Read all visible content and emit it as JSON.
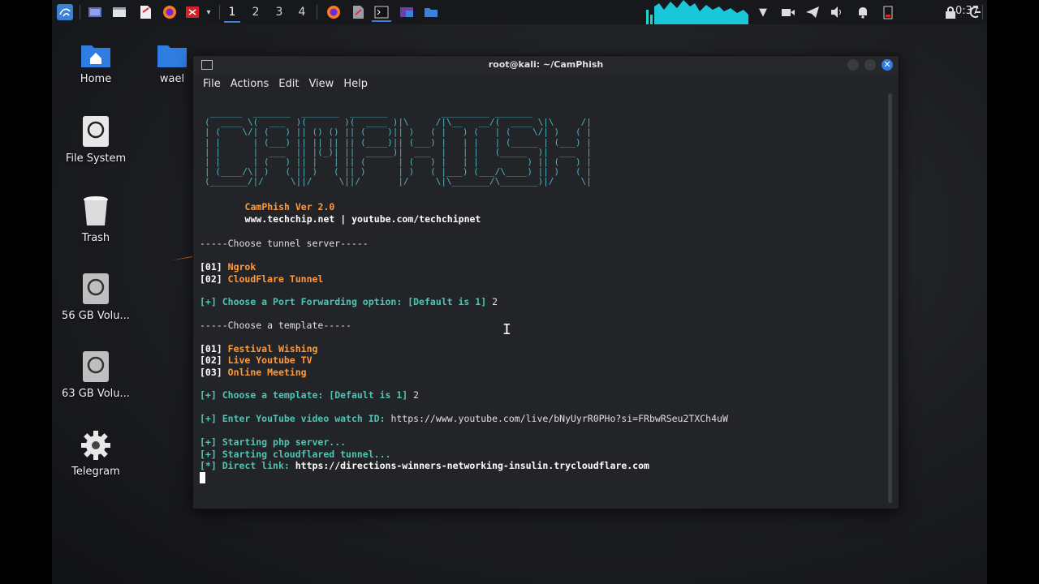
{
  "panel": {
    "workspaces": [
      "1",
      "2",
      "3",
      "4"
    ],
    "active_workspace": "1",
    "clock": "0:37",
    "icons": [
      "kali-menu-icon",
      "show-desktop-icon",
      "file-manager-icon",
      "text-editor-icon",
      "firefox-icon",
      "app-red-icon",
      "chevron-down-icon"
    ],
    "accent": "#3b82d6"
  },
  "desktop": {
    "icons": [
      {
        "label": "Home"
      },
      {
        "label": "wael"
      },
      {
        "label": "File System"
      },
      {
        "label": "Trash"
      },
      {
        "label": "56 GB Volu..."
      },
      {
        "label": "63 GB Volu..."
      },
      {
        "label": "Telegram"
      }
    ]
  },
  "window": {
    "title": "root@kali: ~/CamPhish",
    "menu": [
      "File",
      "Actions",
      "Edit",
      "View",
      "Help"
    ]
  },
  "terminal": {
    "banner": " ______  _______  _______  _______          _________ _______          \n(  ____ \\(  ___  )(       )(  ____ )|\\     /|\\__   __/(  ____ \\|\\     /|\n| (    \\/| (   ) || () () || (    )|| )   ( |   ) (   | (    \\/| )   ( |\n| |      | (___) || || || || (____)|| (___) |   | |   | (_____ | (___) |\n| |      |  ___  || |(_)| ||  _____)|  ___  |   | |   (_____  )|  ___  |\n| |      | (   ) || |   | || (      | (   ) |   | |         ) || (   ) |\n| (____/\\| )   ( || )   ( || )      | )   ( |___) (___/\\____) || )   ( |\n(_______/|/     \\||/     \\||/       |/     \\|\\_______/\\_______)|/     \\|",
    "version": "CamPhish Ver 2.0",
    "site": "www.techchip.net | youtube.com/techchipnet",
    "tunnel_header": "-----Choose tunnel server-----",
    "tunnel_options": [
      {
        "num": "[01]",
        "label": "Ngrok"
      },
      {
        "num": "[02]",
        "label": "CloudFlare Tunnel"
      }
    ],
    "port_prompt_prefix": "[+]",
    "port_prompt": "Choose a Port Forwarding option: [Default is 1]",
    "port_answer": "2",
    "template_header": "-----Choose a template-----",
    "template_options": [
      {
        "num": "[01]",
        "label": "Festival Wishing"
      },
      {
        "num": "[02]",
        "label": "Live Youtube TV"
      },
      {
        "num": "[03]",
        "label": "Online Meeting"
      }
    ],
    "template_prompt_prefix": "[+]",
    "template_prompt": "Choose a template: [Default is 1]",
    "template_answer": "2",
    "video_prompt_prefix": "[+]",
    "video_prompt": "Enter YouTube video watch ID:",
    "video_answer": "https://www.youtube.com/live/bNyUyrR0PHo?si=FRbwRSeu2TXCh4uW",
    "status": [
      {
        "prefix": "[+]",
        "text": "Starting php server..."
      },
      {
        "prefix": "[+]",
        "text": "Starting cloudflared tunnel..."
      }
    ],
    "link_prefix": "[*]",
    "link_label": "Direct link:",
    "link_url": "https://directions-winners-networking-insulin.trycloudflare.com"
  }
}
